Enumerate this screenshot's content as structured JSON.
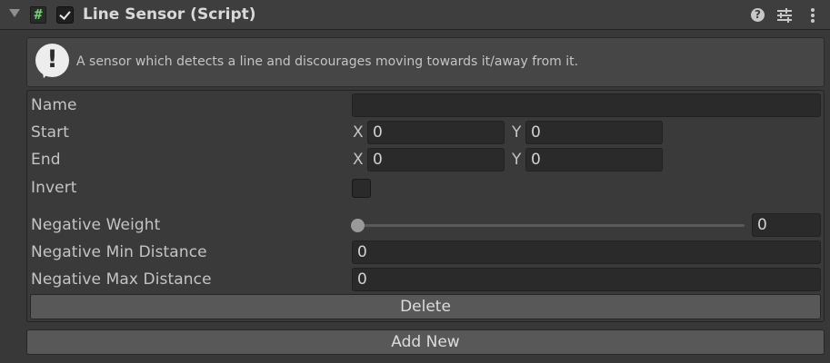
{
  "header": {
    "title": "Line Sensor (Script)",
    "enabled": true,
    "icons": {
      "foldout": "foldout-arrow-icon",
      "script": "script-hash-icon",
      "help": "help-icon",
      "presets": "presets-sliders-icon",
      "menu": "kebab-menu-icon"
    },
    "script_glyph": "#",
    "help_glyph": "?"
  },
  "info": {
    "text": "A sensor which detects a line and discourages moving towards it/away from it.",
    "icon": "warning-icon",
    "icon_glyph": "!"
  },
  "fields": {
    "name": {
      "label": "Name",
      "value": ""
    },
    "start": {
      "label": "Start",
      "x_label": "X",
      "x": "0",
      "y_label": "Y",
      "y": "0"
    },
    "end": {
      "label": "End",
      "x_label": "X",
      "x": "0",
      "y_label": "Y",
      "y": "0"
    },
    "invert": {
      "label": "Invert",
      "checked": false
    },
    "negative_weight": {
      "label": "Negative Weight",
      "value": "0",
      "slider_fraction": 0
    },
    "negative_min_distance": {
      "label": "Negative Min Distance",
      "value": "0"
    },
    "negative_max_distance": {
      "label": "Negative Max Distance",
      "value": "0"
    }
  },
  "buttons": {
    "delete": "Delete",
    "add_new": "Add New"
  },
  "colors": {
    "background": "#383838",
    "script_icon": "#6ed16e",
    "button": "#585858"
  }
}
